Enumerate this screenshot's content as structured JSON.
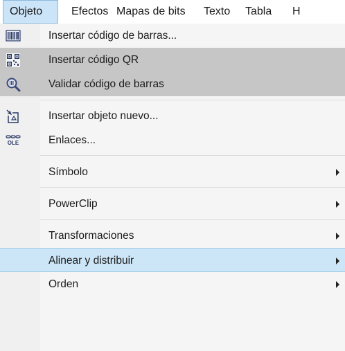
{
  "menubar": {
    "items": [
      "Objeto",
      "Efectos",
      "Mapas de bits",
      "Texto",
      "Tabla",
      "H"
    ]
  },
  "menu": {
    "items": [
      {
        "label": "Insertar código de barras...",
        "icon": "barcode-icon"
      },
      {
        "label": "Insertar código QR",
        "icon": "qr-code-icon"
      },
      {
        "label": "Validar código de barras",
        "icon": "magnifier-icon"
      },
      {
        "label": "Insertar objeto nuevo...",
        "icon": "insert-object-icon"
      },
      {
        "label": "Enlaces...",
        "icon": "ole-links-icon",
        "icon_text": "OLE"
      },
      {
        "label": "Símbolo",
        "has_submenu": true
      },
      {
        "label": "PowerClip",
        "has_submenu": true
      },
      {
        "label": "Transformaciones",
        "has_submenu": true
      },
      {
        "label": "Alinear y distribuir",
        "has_submenu": true
      },
      {
        "label": "Orden",
        "has_submenu": true
      }
    ]
  },
  "colors": {
    "active_menu": "#cce4f7",
    "hover_gray": "#c6c6c6",
    "hover_blue": "#cde6f7"
  }
}
